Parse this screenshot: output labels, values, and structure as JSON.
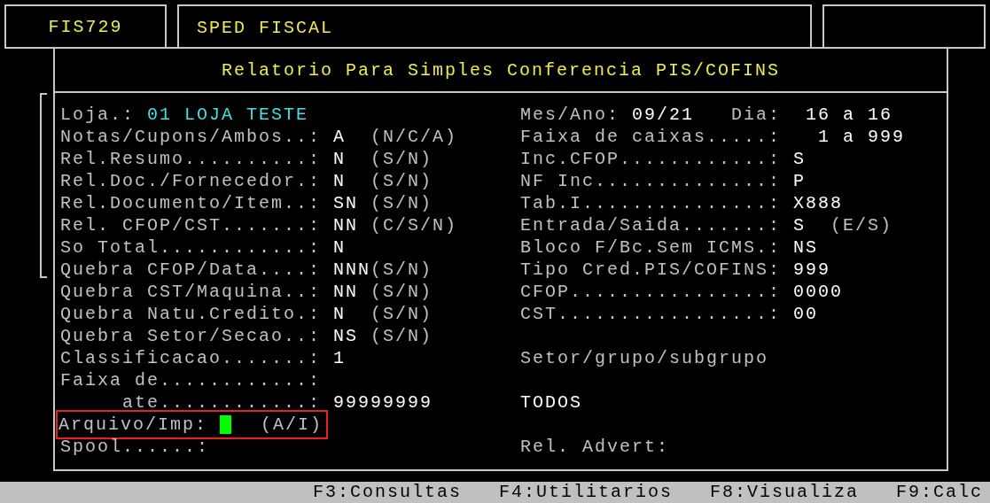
{
  "header": {
    "program_code": "FIS729",
    "module": "SPED FISCAL"
  },
  "dialog": {
    "title": "Relatorio Para Simples Conferencia PIS/COFINS",
    "lines": [
      {
        "left": {
          "kind": "store",
          "label": "Loja.:",
          "value": "01 LOJA TESTE"
        },
        "right": {
          "kind": "date",
          "label": "Mes/Ano:",
          "value": "09/21",
          "label2": "Dia:",
          "value2": "16 a 16"
        }
      },
      {
        "left": {
          "kind": "field",
          "label": "Notas/Cupons/Ambos..:",
          "value": "A",
          "hint": "(N/C/A)"
        },
        "right": {
          "kind": "range",
          "label": "Faixa de caixas.....:",
          "value": "1 a 999"
        }
      },
      {
        "left": {
          "kind": "field",
          "label": "Rel.Resumo..........:",
          "value": "N",
          "hint": "(S/N)"
        },
        "right": {
          "kind": "field",
          "label": "Inc.CFOP............:",
          "value": "S"
        }
      },
      {
        "left": {
          "kind": "field",
          "label": "Rel.Doc./Fornecedor.:",
          "value": "N",
          "hint": "(S/N)"
        },
        "right": {
          "kind": "field",
          "label": "NF Inc..............:",
          "value": "P"
        }
      },
      {
        "left": {
          "kind": "field",
          "label": "Rel.Documento/Item..:",
          "value": "SN",
          "hint": "(S/N)"
        },
        "right": {
          "kind": "field",
          "label": "Tab.I...............:",
          "value": "X888"
        }
      },
      {
        "left": {
          "kind": "field",
          "label": "Rel. CFOP/CST.......:",
          "value": "NN",
          "hint": "(C/S/N)"
        },
        "right": {
          "kind": "field",
          "label": "Entrada/Saida.......:",
          "value": "S",
          "hint": "(E/S)"
        }
      },
      {
        "left": {
          "kind": "field",
          "label": "So Total............:",
          "value": "N"
        },
        "right": {
          "kind": "field",
          "label": "Bloco F/Bc.Sem ICMS.:",
          "value": "NS"
        }
      },
      {
        "left": {
          "kind": "field",
          "label": "Quebra CFOP/Data....:",
          "value": "NNN",
          "hint": "(S/N)"
        },
        "right": {
          "kind": "field",
          "label": "Tipo Cred.PIS/COFINS:",
          "value": "999"
        }
      },
      {
        "left": {
          "kind": "field",
          "label": "Quebra CST/Maquina..:",
          "value": "NN",
          "hint": "(S/N)"
        },
        "right": {
          "kind": "field",
          "label": "CFOP................:",
          "value": "0000"
        }
      },
      {
        "left": {
          "kind": "field",
          "label": "Quebra Natu.Credito.:",
          "value": "N",
          "hint": "(S/N)"
        },
        "right": {
          "kind": "field",
          "label": "CST.................:",
          "value": "00"
        }
      },
      {
        "left": {
          "kind": "field",
          "label": "Quebra Setor/Secao..:",
          "value": "NS",
          "hint": "(S/N)"
        }
      },
      {
        "left": {
          "kind": "field",
          "label": "Classificacao.......:",
          "value": "1"
        },
        "right": {
          "kind": "heading",
          "text": "Setor/grupo/subgrupo"
        }
      },
      {
        "left": {
          "kind": "field",
          "label": "Faixa de............:"
        }
      },
      {
        "left": {
          "kind": "sub",
          "label": "ate............:",
          "value": "99999999"
        },
        "right": {
          "kind": "value",
          "text": "TODOS"
        }
      },
      {
        "left": {
          "kind": "input",
          "label": "Arquivo/Imp:",
          "hint": "(A/I)",
          "focused": true,
          "highlighted": true
        }
      },
      {
        "left": {
          "kind": "field",
          "label": "Spool......:"
        },
        "right": {
          "kind": "field",
          "label": "Rel. Advert:"
        }
      }
    ]
  },
  "function_keys": [
    "F3:Consultas",
    "F4:Utilitarios",
    "F8:Visualiza",
    "F9:Calc"
  ]
}
